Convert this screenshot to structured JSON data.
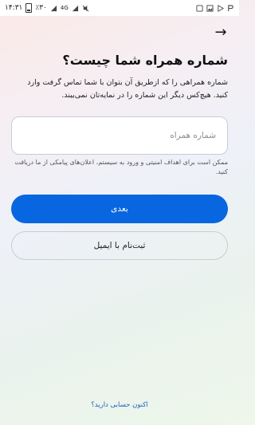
{
  "status_bar": {
    "time": "۱۴:۳۱",
    "battery": "٪۳۰",
    "network": "4G",
    "icons": [
      "signal-icon",
      "wifi-icon",
      "mute-icon",
      "screenshot-icon",
      "image-icon",
      "play-store-icon",
      "app-icon"
    ]
  },
  "header": {
    "back_icon": "arrow-right-icon"
  },
  "main": {
    "title": "شماره همراه شما چیست؟",
    "description": "شماره همراهی را که ازطریق آن بتوان با شما تماس گرفت وارد کنید. هیچ‌کس دیگر این شماره را در نمایه‌تان نمی‌بیند.",
    "phone_placeholder": "شماره همراه",
    "phone_value": "",
    "helper": "ممکن است برای اهداف امنیتی و ورود به سیستم، اعلان‌های پیامکی از ما دریافت کنید.",
    "next_label": "بعدی",
    "email_signup_label": "ثبت‌نام با ایمیل",
    "have_account_link": "اکنون حسابی دارید؟"
  },
  "colors": {
    "primary": "#0866e0",
    "link": "#1d5fbd"
  }
}
